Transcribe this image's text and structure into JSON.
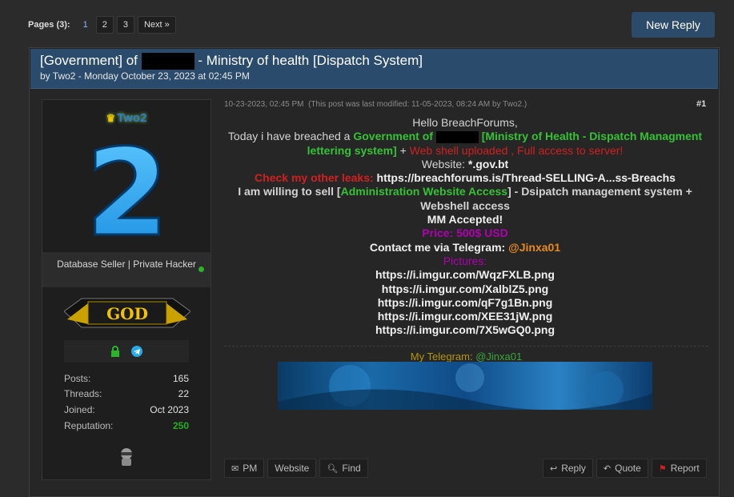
{
  "pagination": {
    "label": "Pages (3):",
    "current": "1",
    "pages": [
      "2",
      "3"
    ],
    "next": "Next »"
  },
  "new_reply_label": "New Reply",
  "thread": {
    "title_prefix": "[Government] of",
    "title_suffix": "- Ministry of health [Dispatch System]",
    "byline": "by Two2 - Monday October 23, 2023 at 02:45 PM"
  },
  "author": {
    "username": "Two2",
    "avatar_text": "2",
    "user_title": "Database Seller | Private Hacker",
    "badge_text": "GOD",
    "stats": [
      {
        "label": "Posts:",
        "value": "165"
      },
      {
        "label": "Threads:",
        "value": "22"
      },
      {
        "label": "Joined:",
        "value": "Oct 2023"
      },
      {
        "label": "Reputation:",
        "value": "250"
      }
    ]
  },
  "post": {
    "date": "10-23-2023, 02:45 PM",
    "modified": "(This post was last modified: 11-05-2023, 08:24 AM by Two2.)",
    "number": "#1",
    "greeting": "Hello BreachForums,",
    "intro": "Today i have breached a",
    "gov_label": "Government of",
    "ministry_label": "[Ministry of Health - Dispatch Managment lettering system]",
    "plus": "+",
    "webshell_text": "Web shell uploaded , Full access to server!",
    "website_label": "Website:",
    "website_value": "*.gov.bt",
    "leaks_label": "Check my other leaks:",
    "leaks_link": "https://breachforums.is/Thread-SELLING-A...ss-Breachs",
    "sell_prefix": "I am willing to sell [",
    "sell_highlight": "Administration Website Access",
    "sell_suffix": "] - Dsipatch management system + Webshell access",
    "mm": "MM Accepted!",
    "price": "Price: 500$ USD",
    "contact_label": "Contact me via Telegram:",
    "contact_handle": "@Jinxa01",
    "pictures_label": "Pictures:",
    "pictures": [
      "https://i.imgur.com/WqzFXLB.png",
      "https://i.imgur.com/XalblZ5.png",
      "https://i.imgur.com/qF7g1Bn.png",
      "https://i.imgur.com/XEE31jW.png",
      "https://i.imgur.com/7X5wGQ0.png"
    ]
  },
  "signature": {
    "label": "My Telegram:",
    "handle": "@Jinxa01"
  },
  "actions_left": [
    {
      "icon": "envelope-icon",
      "label": "PM"
    },
    {
      "icon": "",
      "label": "Website"
    },
    {
      "icon": "search-icon",
      "label": "Find"
    }
  ],
  "actions_right": [
    {
      "icon": "reply-icon",
      "label": "Reply"
    },
    {
      "icon": "quote-icon",
      "label": "Quote"
    },
    {
      "icon": "flag-icon",
      "label": "Report"
    }
  ],
  "colors": {
    "accent": "#2a4b6b",
    "green": "#35c235",
    "red": "#d12020",
    "purple": "#b100b1",
    "orange": "#e78b1a"
  }
}
